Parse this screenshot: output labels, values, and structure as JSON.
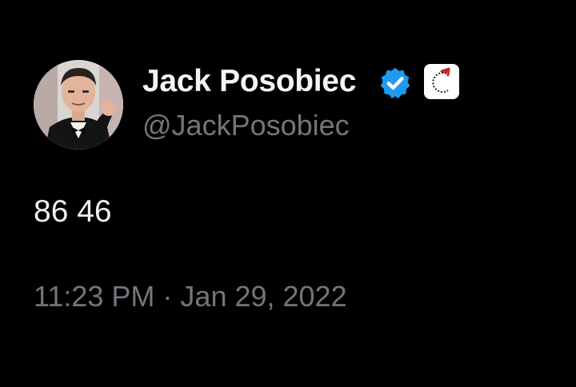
{
  "author": {
    "display_name": "Jack Posobiec",
    "handle": "@JackPosobiec",
    "verified_icon": "verified-badge-icon",
    "affiliate_icon": "affiliate-badge-icon",
    "avatar": "profile-photo"
  },
  "tweet": {
    "text": "86 46",
    "time": "11:23 PM",
    "separator": "·",
    "date": "Jan 29, 2022"
  },
  "colors": {
    "background": "#000000",
    "primary_text": "#e7e9ea",
    "secondary_text": "#71767b",
    "verified_blue": "#1d9bf0",
    "affiliate_red": "#d2221f"
  }
}
